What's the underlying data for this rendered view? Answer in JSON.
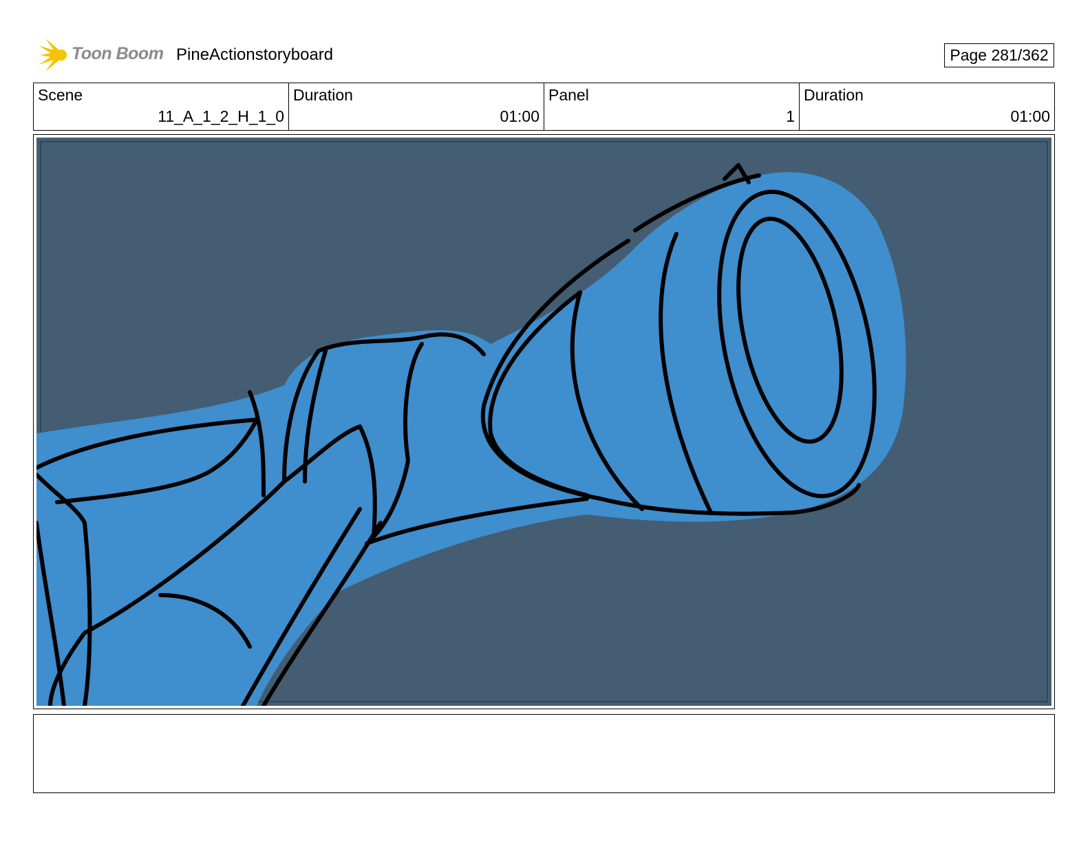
{
  "header": {
    "logo_text": "Toon Boom",
    "project_title": "PineActionstoryboard",
    "page_indicator": "Page 281/362"
  },
  "info": {
    "scene_label": "Scene",
    "scene_value": "11_A_1_2_H_1_0",
    "scene_duration_label": "Duration",
    "scene_duration_value": "01:00",
    "panel_label": "Panel",
    "panel_value": "1",
    "panel_duration_label": "Duration",
    "panel_duration_value": "01:00"
  },
  "notes": {
    "text": ""
  },
  "colors": {
    "background": "#445d72",
    "fill": "#3f8ecd",
    "ink": "#000000",
    "logo_star": "#f5c400"
  }
}
